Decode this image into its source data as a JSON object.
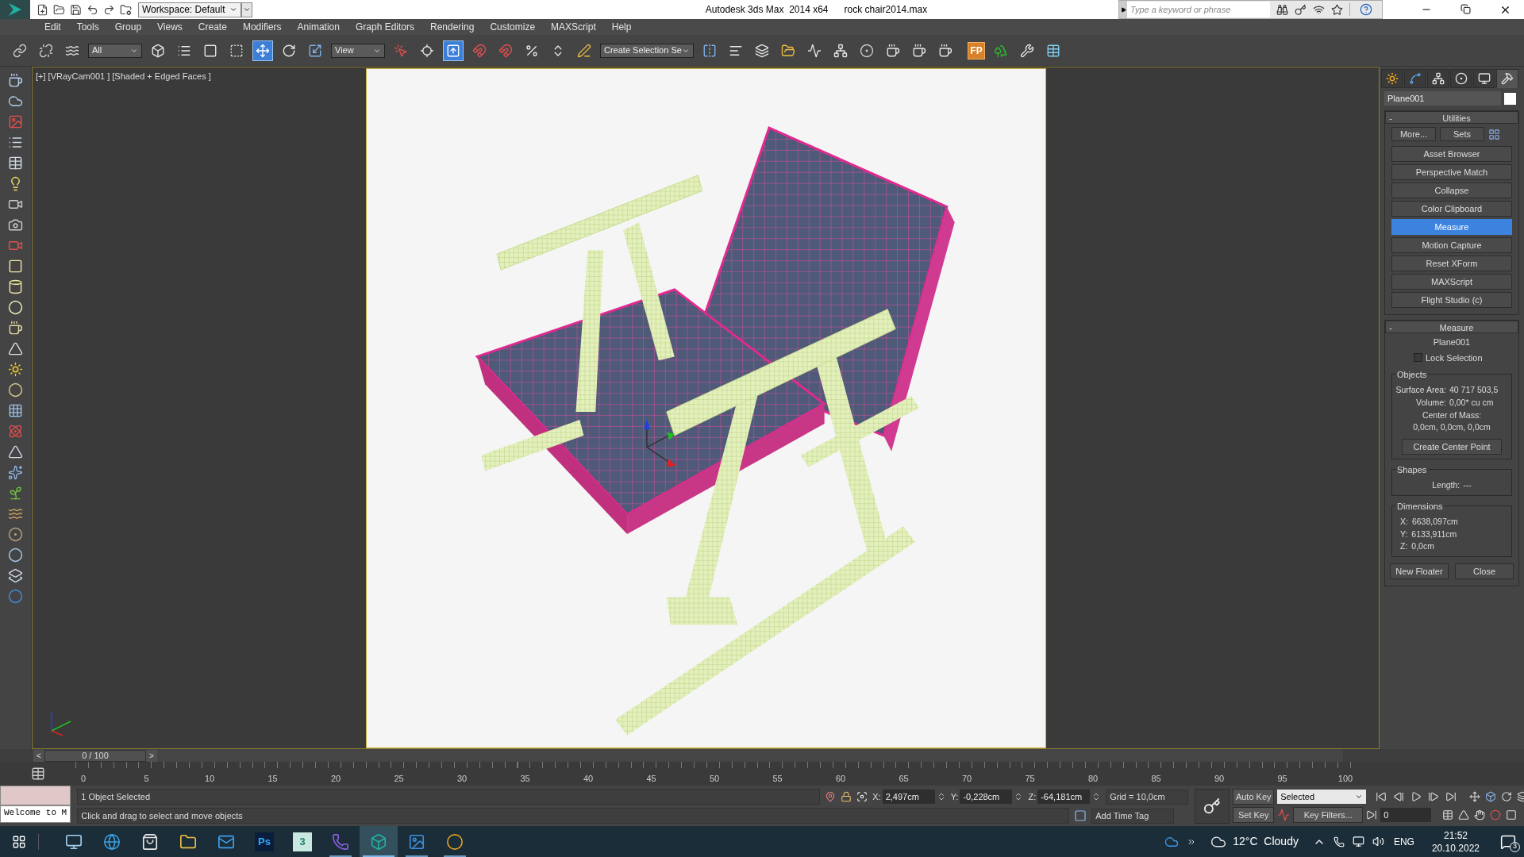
{
  "title_bar": {
    "workspace": "Workspace: Default",
    "app_title": "Autodesk 3ds Max  2014 x64",
    "file_name": "rock chair2014.max",
    "search": {
      "placeholder": "Type a keyword or phrase"
    }
  },
  "menu": [
    "Edit",
    "Tools",
    "Group",
    "Views",
    "Create",
    "Modifiers",
    "Animation",
    "Graph Editors",
    "Rendering",
    "Customize",
    "MAXScript",
    "Help"
  ],
  "toolbar": [
    {
      "kind": "tool",
      "selected": false
    },
    {
      "kind": "tool",
      "selected": false
    },
    {
      "kind": "tool",
      "selected": false
    },
    {
      "kind": "dropdown",
      "value": "All"
    },
    {
      "kind": "tool",
      "selected": false
    },
    {
      "kind": "tool",
      "selected": false
    },
    {
      "kind": "tool",
      "selected": false
    },
    {
      "kind": "tool",
      "selected": false
    },
    {
      "kind": "tool",
      "selected": true
    },
    {
      "kind": "tool",
      "selected": false
    },
    {
      "kind": "tool",
      "selected": false
    },
    {
      "kind": "dropdown",
      "value": "View"
    },
    {
      "kind": "tool",
      "selected": false
    },
    {
      "kind": "tool",
      "selected": false
    },
    {
      "kind": "tool",
      "selected": true
    },
    {
      "kind": "tool",
      "selected": false
    },
    {
      "kind": "tool",
      "selected": false
    },
    {
      "kind": "tool",
      "selected": false
    },
    {
      "kind": "tool",
      "selected": false
    },
    {
      "kind": "tool",
      "selected": false
    },
    {
      "kind": "dropdown",
      "value": "Create Selection Se"
    },
    {
      "kind": "tool",
      "selected": false
    },
    {
      "kind": "tool",
      "selected": false
    },
    {
      "kind": "tool",
      "selected": false
    },
    {
      "kind": "tool",
      "selected": false
    },
    {
      "kind": "tool",
      "selected": false
    },
    {
      "kind": "tool",
      "selected": false
    },
    {
      "kind": "tool",
      "selected": false
    },
    {
      "kind": "tool",
      "selected": false
    },
    {
      "kind": "tool",
      "selected": false
    },
    {
      "kind": "tool",
      "selected": false
    },
    {
      "kind": "text_tool",
      "label": "FP"
    },
    {
      "kind": "tool",
      "selected": false
    },
    {
      "kind": "tool",
      "selected": false
    },
    {
      "kind": "tool",
      "selected": false
    }
  ],
  "viewport": {
    "label": "[+] [VRayCam001 ] [Shaded + Edged Faces ]"
  },
  "command_panel": {
    "tabs": [
      {
        "selected": false
      },
      {
        "selected": false
      },
      {
        "selected": false
      },
      {
        "selected": false
      },
      {
        "selected": false
      },
      {
        "selected": true
      }
    ],
    "object_name": "Plane001",
    "utilities": {
      "collapse": "-",
      "title": "Utilities",
      "more": "More...",
      "sets": "Sets",
      "buttons": [
        {
          "label": "Asset Browser",
          "selected": false
        },
        {
          "label": "Perspective Match",
          "selected": false
        },
        {
          "label": "Collapse",
          "selected": false
        },
        {
          "label": "Color Clipboard",
          "selected": false
        },
        {
          "label": "Measure",
          "selected": true
        },
        {
          "label": "Motion Capture",
          "selected": false
        },
        {
          "label": "Reset XForm",
          "selected": false
        },
        {
          "label": "MAXScript",
          "selected": false
        },
        {
          "label": "Flight Studio (c)",
          "selected": false
        }
      ]
    },
    "measure": {
      "collapse": "-",
      "title": "Measure",
      "object": "Plane001",
      "lock_selection": {
        "label": "Lock Selection",
        "checked": false
      },
      "objects": {
        "title": "Objects",
        "rows": [
          {
            "label": "Surface Area:",
            "value": "40 717 503,5"
          },
          {
            "label": "Volume:",
            "value": "0,00* cu cm"
          }
        ],
        "center_label": "Center of Mass:",
        "center_value": "0,0cm, 0,0cm, 0,0cm",
        "button": "Create Center Point"
      },
      "shapes": {
        "title": "Shapes",
        "label": "Length:",
        "value": "---"
      },
      "dimensions": {
        "title": "Dimensions",
        "rows": [
          {
            "label": "X:",
            "value": "6638,097cm"
          },
          {
            "label": "Y:",
            "value": "6133,911cm"
          },
          {
            "label": "Z:",
            "value": "0,0cm"
          }
        ]
      },
      "buttons": [
        "New Floater",
        "Close"
      ]
    }
  },
  "timeline": {
    "level": 0,
    "prev": "<",
    "position": "0 / 100",
    "next": ">",
    "ticks": [
      "0",
      "5",
      "10",
      "15",
      "20",
      "25",
      "30",
      "35",
      "40",
      "45",
      "50",
      "55",
      "60",
      "65",
      "70",
      "75",
      "80",
      "85",
      "90",
      "95",
      "100"
    ]
  },
  "status_bar": {
    "listener": "Welcome to M",
    "selection": "1 Object Selected",
    "prompt": "Click and drag to select and move objects",
    "coords": [
      {
        "label": "X:",
        "value": "2,497cm"
      },
      {
        "label": "Y:",
        "value": "-0,228cm"
      },
      {
        "label": "Z:",
        "value": "-64,181cm"
      }
    ],
    "grid": "Grid = 10,0cm",
    "time_tag": "Add Time Tag",
    "auto_key": "Auto Key",
    "set_key": "Set Key",
    "key_mode": "Selected",
    "key_filters": "Key Filters...",
    "frame": "0"
  },
  "taskbar": {
    "apps": [
      {
        "running": false,
        "selected": false
      },
      {
        "running": false,
        "selected": false
      },
      {
        "running": false,
        "selected": false
      },
      {
        "running": false,
        "selected": false
      },
      {
        "running": false,
        "selected": false
      },
      {
        "label": "Ps",
        "running": false,
        "selected": false
      },
      {
        "label": "3",
        "running": false,
        "selected": false
      },
      {
        "running": true,
        "selected": false
      },
      {
        "running": true,
        "selected": true
      },
      {
        "running": true,
        "selected": false
      },
      {
        "running": true,
        "selected": false
      }
    ],
    "weather": "12°C  Cloudy",
    "language": "ENG",
    "time": "21:52",
    "date": "20.10.2022",
    "notifications": "3"
  }
}
